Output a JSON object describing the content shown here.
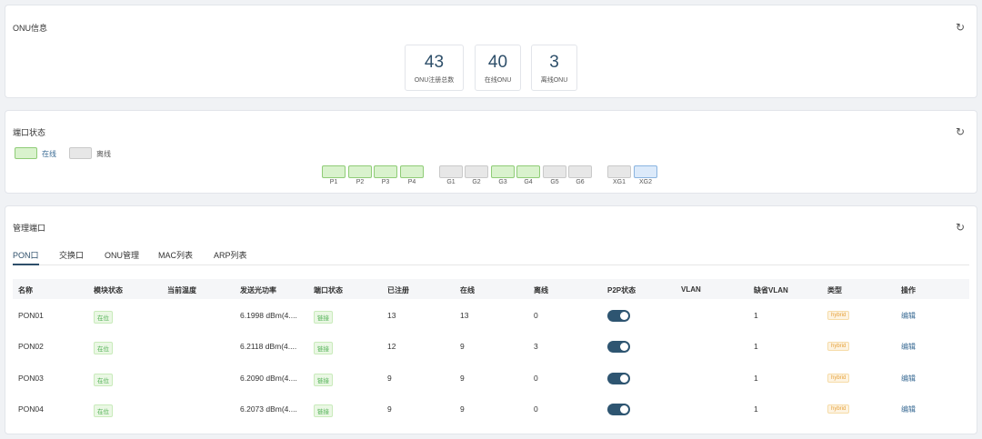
{
  "onu_info": {
    "title": "ONU信息",
    "stats": [
      {
        "value": "43",
        "label": "ONU注册总数"
      },
      {
        "value": "40",
        "label": "在线ONU"
      },
      {
        "value": "3",
        "label": "离线ONU"
      }
    ]
  },
  "port_status": {
    "title": "端口状态",
    "legend": {
      "online": "在线",
      "offline": "离线"
    },
    "ports": [
      {
        "name": "P1",
        "state": "online"
      },
      {
        "name": "P2",
        "state": "online"
      },
      {
        "name": "P3",
        "state": "online"
      },
      {
        "name": "P4",
        "state": "online"
      },
      {
        "name": "G1",
        "state": "offline"
      },
      {
        "name": "G2",
        "state": "offline"
      },
      {
        "name": "G3",
        "state": "online"
      },
      {
        "name": "G4",
        "state": "online"
      },
      {
        "name": "G5",
        "state": "offline"
      },
      {
        "name": "G6",
        "state": "offline"
      },
      {
        "name": "XG1",
        "state": "offline"
      },
      {
        "name": "XG2",
        "state": "selected"
      }
    ],
    "colors": {
      "online": "#d9f2cd",
      "offline": "#e7e7e7",
      "selected": "#dceafa"
    }
  },
  "management": {
    "title": "管理端口",
    "tabs": [
      "PON口",
      "交换口",
      "ONU管理",
      "MAC列表",
      "ARP列表"
    ],
    "active_tab": "PON口",
    "columns": [
      "名称",
      "模块状态",
      "当前温度",
      "发送光功率",
      "端口状态",
      "已注册",
      "在线",
      "离线",
      "P2P状态",
      "VLAN",
      "缺省VLAN",
      "类型",
      "操作"
    ],
    "rows": [
      {
        "name": "PON01",
        "module": "在位",
        "temp": "",
        "power": "6.1998 dBm(4....",
        "port_state": "链接",
        "registered": "13",
        "online": "13",
        "offline": "0",
        "p2p": true,
        "vlan": "",
        "default_vlan": "1",
        "type": "hybrid",
        "action": "编辑"
      },
      {
        "name": "PON02",
        "module": "在位",
        "temp": "",
        "power": "6.2118 dBm(4....",
        "port_state": "链接",
        "registered": "12",
        "online": "9",
        "offline": "3",
        "p2p": true,
        "vlan": "",
        "default_vlan": "1",
        "type": "hybrid",
        "action": "编辑"
      },
      {
        "name": "PON03",
        "module": "在位",
        "temp": "",
        "power": "6.2090 dBm(4....",
        "port_state": "链接",
        "registered": "9",
        "online": "9",
        "offline": "0",
        "p2p": true,
        "vlan": "",
        "default_vlan": "1",
        "type": "hybrid",
        "action": "编辑"
      },
      {
        "name": "PON04",
        "module": "在位",
        "temp": "",
        "power": "6.2073 dBm(4....",
        "port_state": "链接",
        "registered": "9",
        "online": "9",
        "offline": "0",
        "p2p": true,
        "vlan": "",
        "default_vlan": "1",
        "type": "hybrid",
        "action": "编辑"
      }
    ]
  }
}
